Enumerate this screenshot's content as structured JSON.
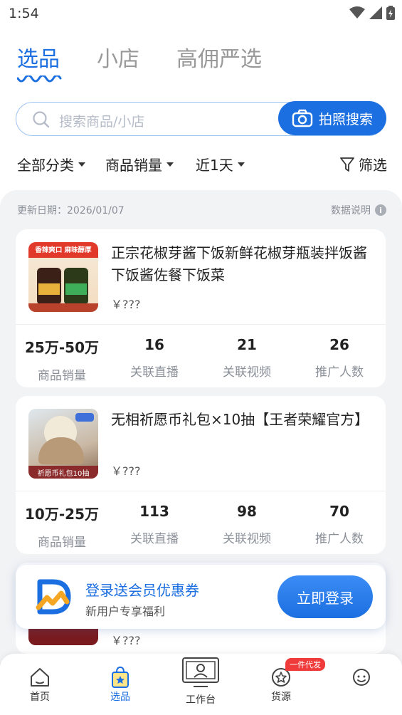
{
  "status_bar": {
    "time": "1:54"
  },
  "tabs": [
    {
      "label": "选品",
      "active": true
    },
    {
      "label": "小店",
      "active": false
    },
    {
      "label": "高佣严选",
      "active": false
    }
  ],
  "search": {
    "placeholder": "搜索商品/小店",
    "photo_button": "拍照搜索"
  },
  "filters": {
    "category": "全部分类",
    "sales": "商品销量",
    "period": "近1天",
    "filter": "筛选"
  },
  "panel": {
    "update_date": "更新日期：2026/01/07",
    "data_note": "数据说明"
  },
  "products": [
    {
      "title": "正宗花椒芽酱下饭新鲜花椒芽瓶装拌饭酱下饭酱佐餐下饭菜",
      "price": "￥???",
      "thumb_text": "香辣爽口 麻味醇厚",
      "stats": [
        {
          "value": "25万-50万",
          "label": "商品销量"
        },
        {
          "value": "16",
          "label": "关联直播"
        },
        {
          "value": "21",
          "label": "关联视频"
        },
        {
          "value": "26",
          "label": "推广人数"
        }
      ]
    },
    {
      "title": "无相祈愿币礼包×10抽【王者荣耀官方】",
      "price": "￥???",
      "thumb_text": "祈愿币礼包10抽",
      "stats": [
        {
          "value": "10万-25万",
          "label": "商品销量"
        },
        {
          "value": "113",
          "label": "关联直播"
        },
        {
          "value": "98",
          "label": "关联视频"
        },
        {
          "value": "70",
          "label": "推广人数"
        }
      ]
    }
  ],
  "promo": {
    "title": "登录送会员优惠券",
    "subtitle": "新用户专享福利",
    "button": "立即登录"
  },
  "peek_price": "￥???",
  "bottom_nav": [
    {
      "label": "首页",
      "icon": "home-icon",
      "active": false
    },
    {
      "label": "选品",
      "icon": "shopping-bag-icon",
      "active": true
    },
    {
      "label": "工作台",
      "icon": "monitor-icon",
      "active": false
    },
    {
      "label": "货源",
      "icon": "goods-source-icon",
      "active": false,
      "badge": "一件代发"
    },
    {
      "label": "",
      "icon": "profile-icon",
      "active": false
    }
  ],
  "colors": {
    "accent": "#1c6fe0",
    "background": "#f2f3f5"
  }
}
